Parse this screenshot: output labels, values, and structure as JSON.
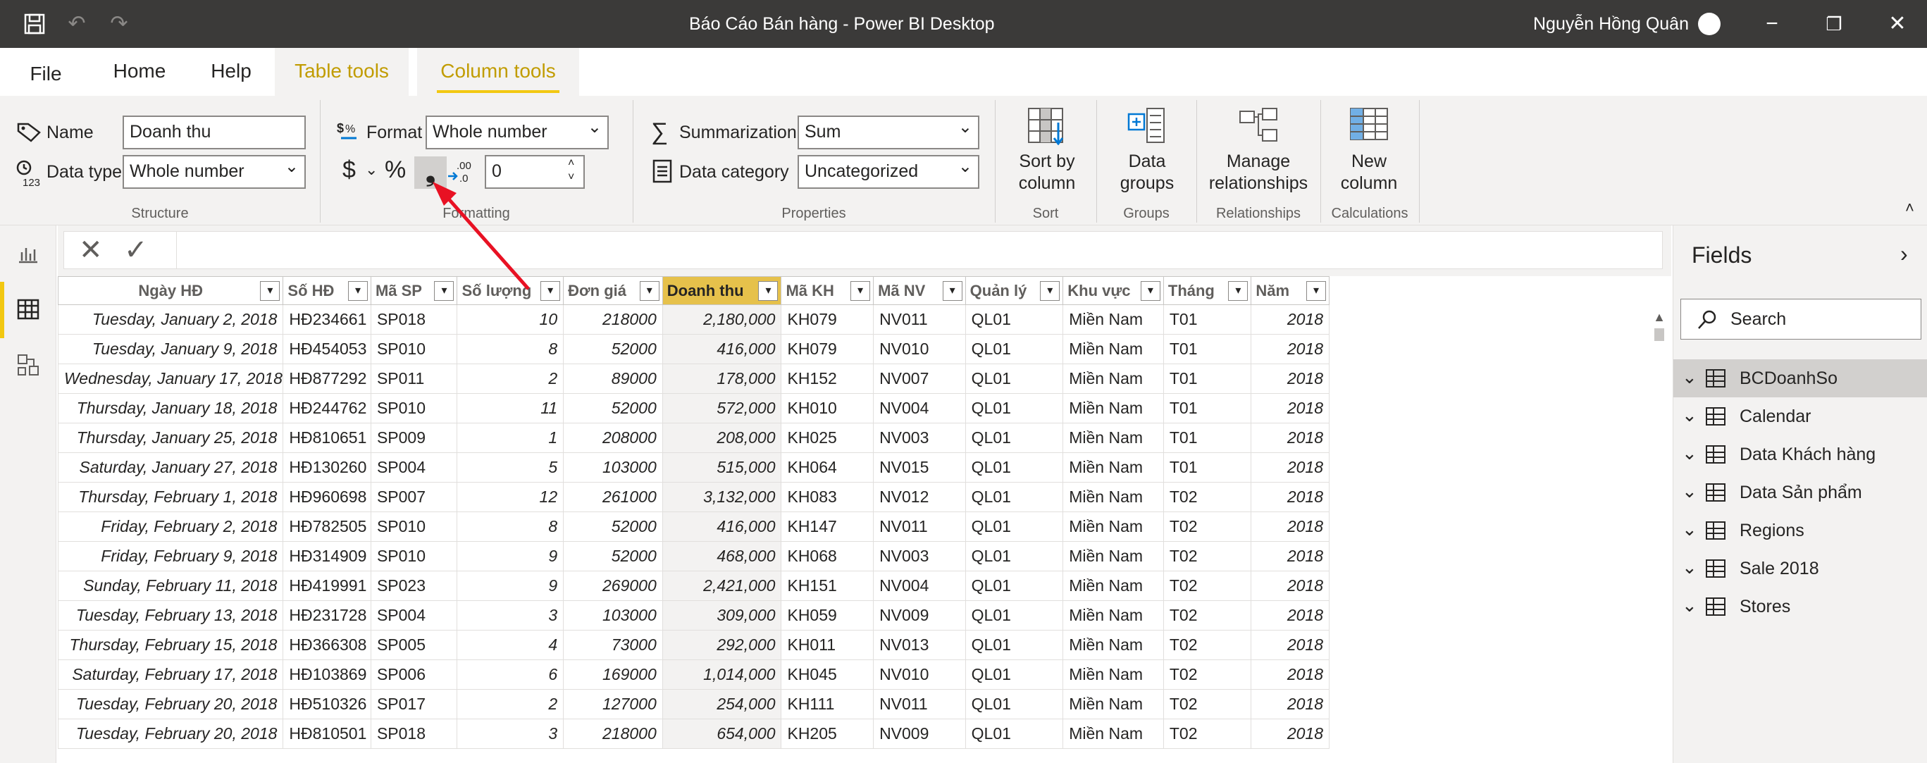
{
  "window": {
    "title": "Báo Cáo Bán hàng - Power BI Desktop",
    "user": "Nguyễn Hồng Quân"
  },
  "tabs": [
    "File",
    "Home",
    "Help",
    "Table tools",
    "Column tools"
  ],
  "ribbon": {
    "structure": {
      "name_label": "Name",
      "name_value": "Doanh thu",
      "datatype_label": "Data type",
      "datatype_value": "Whole number",
      "group": "Structure"
    },
    "formatting": {
      "format_label": "Format",
      "format_value": "Whole number",
      "currency_symbol": "$",
      "percent_symbol": "%",
      "comma_symbol": "❟",
      "decimals_value": "0",
      "group": "Formatting"
    },
    "properties": {
      "summarization_label": "Summarization",
      "summarization_value": "Sum",
      "category_label": "Data category",
      "category_value": "Uncategorized",
      "group": "Properties"
    },
    "sort": {
      "line1": "Sort by",
      "line2": "column",
      "group": "Sort"
    },
    "groups": {
      "line1": "Data",
      "line2": "groups",
      "group": "Groups"
    },
    "relationships": {
      "line1": "Manage",
      "line2": "relationships",
      "group": "Relationships"
    },
    "calculations": {
      "line1": "New",
      "line2": "column",
      "group": "Calculations"
    }
  },
  "table": {
    "columns": [
      "Ngày HĐ",
      "Số HĐ",
      "Mã SP",
      "Số lượng",
      "Đơn giá",
      "Doanh thu",
      "Mã KH",
      "Mã NV",
      "Quản lý",
      "Khu vực",
      "Tháng",
      "Năm"
    ],
    "rows": [
      [
        "Tuesday, January 2, 2018",
        "HĐ234661",
        "SP018",
        "10",
        "218000",
        "2,180,000",
        "KH079",
        "NV011",
        "QL01",
        "Miền Nam",
        "T01",
        "2018"
      ],
      [
        "Tuesday, January 9, 2018",
        "HĐ454053",
        "SP010",
        "8",
        "52000",
        "416,000",
        "KH079",
        "NV010",
        "QL01",
        "Miền Nam",
        "T01",
        "2018"
      ],
      [
        "Wednesday, January 17, 2018",
        "HĐ877292",
        "SP011",
        "2",
        "89000",
        "178,000",
        "KH152",
        "NV007",
        "QL01",
        "Miền Nam",
        "T01",
        "2018"
      ],
      [
        "Thursday, January 18, 2018",
        "HĐ244762",
        "SP010",
        "11",
        "52000",
        "572,000",
        "KH010",
        "NV004",
        "QL01",
        "Miền Nam",
        "T01",
        "2018"
      ],
      [
        "Thursday, January 25, 2018",
        "HĐ810651",
        "SP009",
        "1",
        "208000",
        "208,000",
        "KH025",
        "NV003",
        "QL01",
        "Miền Nam",
        "T01",
        "2018"
      ],
      [
        "Saturday, January 27, 2018",
        "HĐ130260",
        "SP004",
        "5",
        "103000",
        "515,000",
        "KH064",
        "NV015",
        "QL01",
        "Miền Nam",
        "T01",
        "2018"
      ],
      [
        "Thursday, February 1, 2018",
        "HĐ960698",
        "SP007",
        "12",
        "261000",
        "3,132,000",
        "KH083",
        "NV012",
        "QL01",
        "Miền Nam",
        "T02",
        "2018"
      ],
      [
        "Friday, February 2, 2018",
        "HĐ782505",
        "SP010",
        "8",
        "52000",
        "416,000",
        "KH147",
        "NV011",
        "QL01",
        "Miền Nam",
        "T02",
        "2018"
      ],
      [
        "Friday, February 9, 2018",
        "HĐ314909",
        "SP010",
        "9",
        "52000",
        "468,000",
        "KH068",
        "NV003",
        "QL01",
        "Miền Nam",
        "T02",
        "2018"
      ],
      [
        "Sunday, February 11, 2018",
        "HĐ419991",
        "SP023",
        "9",
        "269000",
        "2,421,000",
        "KH151",
        "NV004",
        "QL01",
        "Miền Nam",
        "T02",
        "2018"
      ],
      [
        "Tuesday, February 13, 2018",
        "HĐ231728",
        "SP004",
        "3",
        "103000",
        "309,000",
        "KH059",
        "NV009",
        "QL01",
        "Miền Nam",
        "T02",
        "2018"
      ],
      [
        "Thursday, February 15, 2018",
        "HĐ366308",
        "SP005",
        "4",
        "73000",
        "292,000",
        "KH011",
        "NV013",
        "QL01",
        "Miền Nam",
        "T02",
        "2018"
      ],
      [
        "Saturday, February 17, 2018",
        "HĐ103869",
        "SP006",
        "6",
        "169000",
        "1,014,000",
        "KH045",
        "NV010",
        "QL01",
        "Miền Nam",
        "T02",
        "2018"
      ],
      [
        "Tuesday, February 20, 2018",
        "HĐ510326",
        "SP017",
        "2",
        "127000",
        "254,000",
        "KH111",
        "NV011",
        "QL01",
        "Miền Nam",
        "T02",
        "2018"
      ],
      [
        "Tuesday, February 20, 2018",
        "HĐ810501",
        "SP018",
        "3",
        "218000",
        "654,000",
        "KH205",
        "NV009",
        "QL01",
        "Miền Nam",
        "T02",
        "2018"
      ]
    ]
  },
  "fields": {
    "title": "Fields",
    "search_placeholder": "Search",
    "tables": [
      "BCDoanhSo",
      "Calendar",
      "Data Khách hàng",
      "Data Sản phẩm",
      "Regions",
      "Sale 2018",
      "Stores"
    ]
  },
  "accent_color": "#f2c811",
  "annotation_color": "#e81123"
}
